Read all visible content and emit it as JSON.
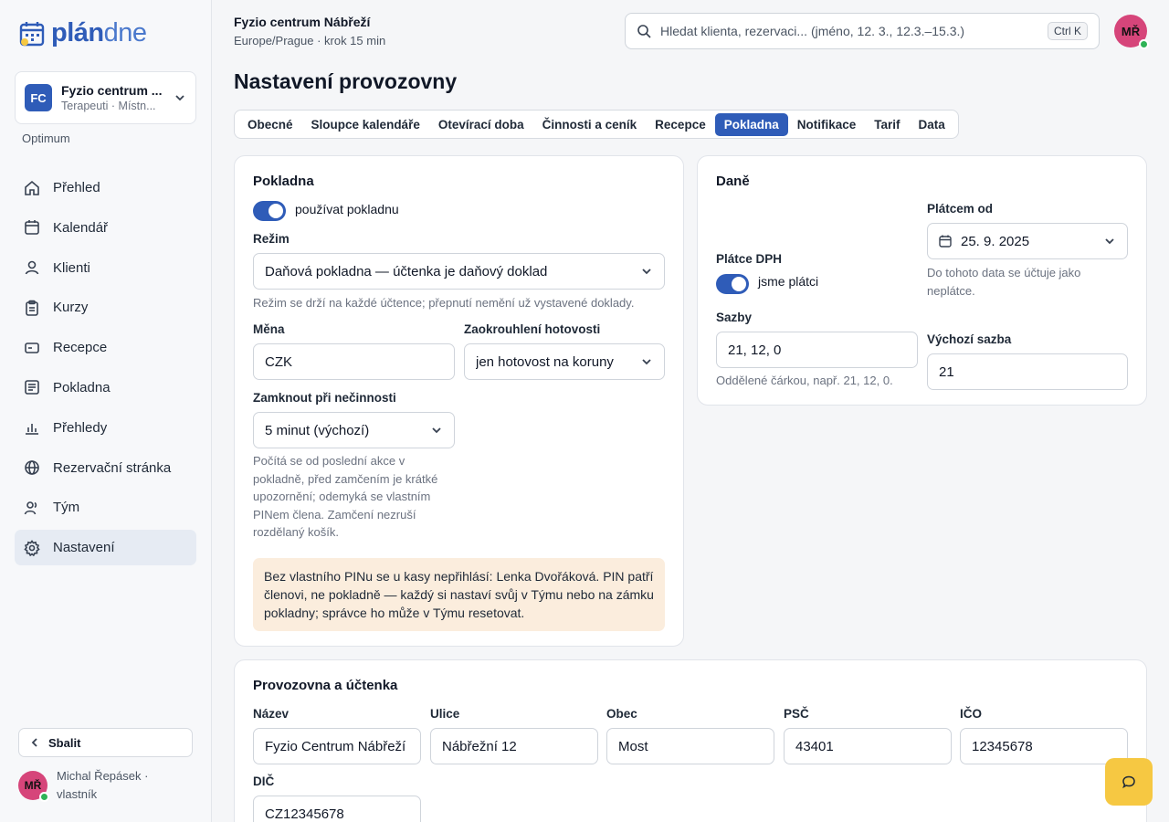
{
  "brand": {
    "logo_bold": "plán",
    "logo_light": "dne"
  },
  "org": {
    "initials": "FC",
    "name": "Fyzio centrum ...",
    "sub": "Terapeuti · Místn..."
  },
  "plan": "Optimum",
  "nav": [
    {
      "label": "Přehled",
      "icon": "home-icon"
    },
    {
      "label": "Kalendář",
      "icon": "calendar-icon"
    },
    {
      "label": "Klienti",
      "icon": "user-icon"
    },
    {
      "label": "Kurzy",
      "icon": "clipboard-icon"
    },
    {
      "label": "Recepce",
      "icon": "card-icon"
    },
    {
      "label": "Pokladna",
      "icon": "receipt-icon"
    },
    {
      "label": "Přehledy",
      "icon": "bar-chart-icon"
    },
    {
      "label": "Rezervační stránka",
      "icon": "globe-icon"
    },
    {
      "label": "Tým",
      "icon": "team-icon"
    },
    {
      "label": "Nastavení",
      "icon": "gear-icon",
      "active": true
    }
  ],
  "collapse_label": "Sbalit",
  "user": {
    "initials": "MŘ",
    "line1": "Michal Řepásek ·",
    "line2": "vlastník"
  },
  "header": {
    "title": "Fyzio centrum Nábřeží",
    "sub": "Europe/Prague · krok 15 min",
    "search_placeholder": "Hledat klienta, rezervaci... (jméno, 12. 3., 12.3.–15.3.)",
    "shortcut": "Ctrl K"
  },
  "page_title": "Nastavení provozovny",
  "tabs": [
    "Obecné",
    "Sloupce kalendáře",
    "Otevírací doba",
    "Činnosti a ceník",
    "Recepce",
    "Pokladna",
    "Notifikace",
    "Tarif",
    "Data"
  ],
  "active_tab": "Pokladna",
  "pokladna": {
    "title": "Pokladna",
    "toggle_label": "používat pokladnu",
    "mode_label": "Režim",
    "mode_value": "Daňová pokladna — účtenka je daňový doklad",
    "mode_help": "Režim se drží na každé účtence; přepnutí nemění už vystavené doklady.",
    "currency_label": "Měna",
    "currency_value": "CZK",
    "rounding_label": "Zaokrouhlení hotovosti",
    "rounding_value": "jen hotovost na koruny",
    "lock_label": "Zamknout při nečinnosti",
    "lock_value": "5 minut (výchozí)",
    "lock_help": "Počítá se od poslední akce v pokladně, před zamčením je krátké upozornění; odemyká se vlastním PINem člena. Zamčení nezruší rozdělaný košík.",
    "warning": "Bez vlastního PINu se u kasy nepřihlásí: Lenka Dvořáková. PIN patří členovi, ne pokladně — každý si nastaví svůj v Týmu nebo na zámku pokladny; správce ho může v Týmu resetovat."
  },
  "dane": {
    "title": "Daně",
    "vat_label": "Plátce DPH",
    "vat_toggle_label": "jsme plátci",
    "since_label": "Plátcem od",
    "since_value": "25. 9. 2025",
    "since_help": "Do tohoto data se účtuje jako neplátce.",
    "rates_label": "Sazby",
    "rates_value": "21, 12, 0",
    "rates_help": "Oddělené čárkou, např. 21, 12, 0.",
    "default_rate_label": "Výchozí sazba",
    "default_rate_value": "21"
  },
  "provozovna": {
    "title": "Provozovna a účtenka",
    "fields": [
      {
        "label": "Název",
        "value": "Fyzio Centrum Nábřeží"
      },
      {
        "label": "Ulice",
        "value": "Nábřežní 12"
      },
      {
        "label": "Obec",
        "value": "Most"
      },
      {
        "label": "PSČ",
        "value": "43401"
      },
      {
        "label": "IČO",
        "value": "12345678"
      }
    ],
    "dic_label": "DIČ",
    "dic_value": "CZ12345678"
  }
}
